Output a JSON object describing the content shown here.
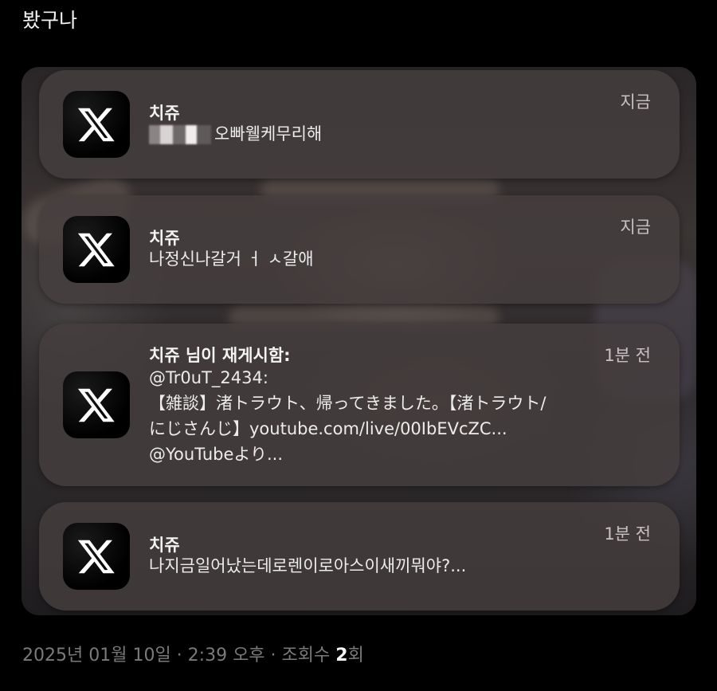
{
  "post": {
    "text": "봤구나"
  },
  "notifications": [
    {
      "app": "X",
      "title": "치쥬",
      "time": "지금",
      "lines": [
        "오빠웰케무리해"
      ],
      "redacted_prefix": true
    },
    {
      "app": "X",
      "title": "치쥬",
      "time": "지금",
      "lines": [
        "나정신나갈거 ㅓ ㅅ갈애"
      ]
    },
    {
      "app": "X",
      "title": "치쥬 님이 재게시함:",
      "time": "1분 전",
      "lines": [
        "@Tr0uT_2434:",
        "【雑談】渚トラウト、帰ってきました。【渚トラウト/",
        "にじさんじ】youtube.com/live/00IbEVcZC...",
        "@YouTubeより..."
      ]
    },
    {
      "app": "X",
      "title": "치쥬",
      "time": "1분 전",
      "lines": [
        "나지금일어났는데로렌이로아스이새끼뭐야?..."
      ]
    }
  ],
  "meta": {
    "date": "2025년 01월 10일",
    "sep1": " · ",
    "time": "2:39 오후",
    "sep2": " · ",
    "views_label": "조회수 ",
    "views_count": "2",
    "views_suffix": "회"
  },
  "icons": {
    "app_icon": "x-logo-icon"
  },
  "colors": {
    "background": "#000000",
    "card": "#463e3e",
    "meta_text": "#7a7a7a"
  }
}
